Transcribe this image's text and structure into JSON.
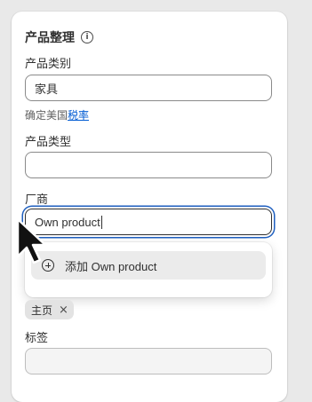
{
  "section": {
    "title": "产品整理",
    "info_icon": "info-icon"
  },
  "category": {
    "label": "产品类别",
    "value": "家具",
    "helper_prefix": "确定美国",
    "helper_link": "税率"
  },
  "product_type": {
    "label": "产品类型",
    "value": ""
  },
  "vendor": {
    "label": "厂商",
    "value": "Own product",
    "suggestion": "添加 Own product",
    "suggestion_icon": "add-circle-icon"
  },
  "collections": {
    "tags": [
      {
        "label": "主页",
        "remove_icon": "close-icon"
      }
    ]
  },
  "tags_field": {
    "label": "标签",
    "value": ""
  },
  "pointer_icon": "mouse-pointer-icon",
  "colors": {
    "focus_ring": "#1f5fbf",
    "link": "#005bd3"
  }
}
